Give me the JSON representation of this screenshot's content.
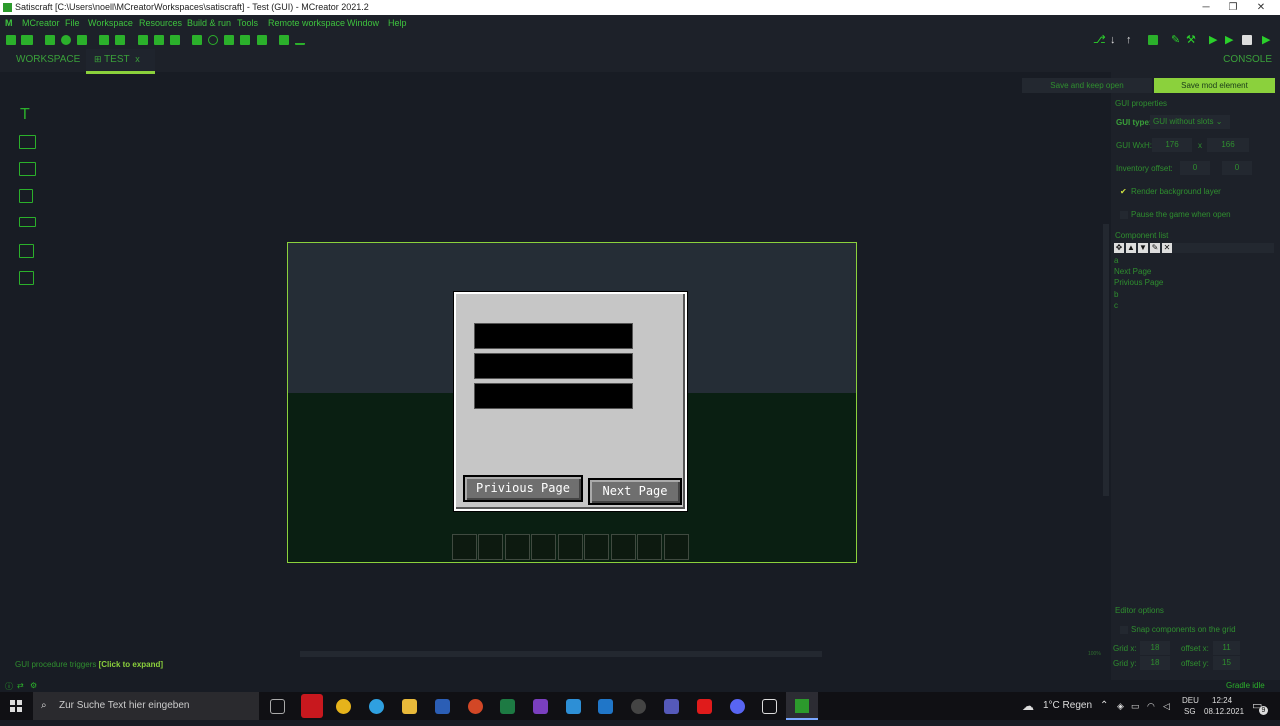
{
  "window": {
    "title": "Satiscraft [C:\\Users\\noell\\MCreatorWorkspaces\\satiscraft] - Test (GUI) - MCreator 2021.2",
    "minimize": "─",
    "maximize": "❐",
    "close": "✕"
  },
  "menu": [
    "MCreator",
    "File",
    "Workspace",
    "Resources",
    "Build & run",
    "Tools",
    "Remote workspace",
    "Window",
    "Help"
  ],
  "tabs": {
    "workspace": "WORKSPACE",
    "test": "TEST",
    "test_close": "x",
    "console": "CONSOLE"
  },
  "actions": {
    "keep_open": "Save and keep open",
    "save": "Save mod element"
  },
  "gui_properties": {
    "heading": "GUI properties",
    "gui_type_label": "GUI type:",
    "gui_type_value": "GUI without slots",
    "wxh_label": "GUI WxH:",
    "width": "176",
    "x": "x",
    "height": "166",
    "inventory_offset_label": "Inventory offset:",
    "offset_x": "0",
    "offset_y": "0",
    "render_bg": "Render background layer",
    "pause_game": "Pause the game when open"
  },
  "component_list": {
    "heading": "Component list",
    "items": [
      "a",
      "Next Page",
      "Privious Page",
      "b",
      "c"
    ]
  },
  "editor_options": {
    "heading": "Editor options",
    "snap": "Snap components on the grid",
    "grid_x_label": "Grid x:",
    "grid_x": "18",
    "grid_y_label": "Grid y:",
    "grid_y": "18",
    "offset_x_label": "offset x:",
    "offset_x": "11",
    "offset_y_label": "offset y:",
    "offset_y": "15"
  },
  "preview": {
    "prev_button": "Privious Page",
    "next_button": "Next Page",
    "zoom": "100%"
  },
  "footer": {
    "triggers": "GUI procedure triggers",
    "triggers_expand": "[Click to expand]",
    "gradle": "Gradle idle"
  },
  "taskbar": {
    "search_placeholder": "Zur Suche Text hier eingeben",
    "weather": "1°C  Regen",
    "lang": "DEU",
    "region": "SG",
    "time": "12:24",
    "date": "08.12.2021",
    "notifications": "9"
  }
}
